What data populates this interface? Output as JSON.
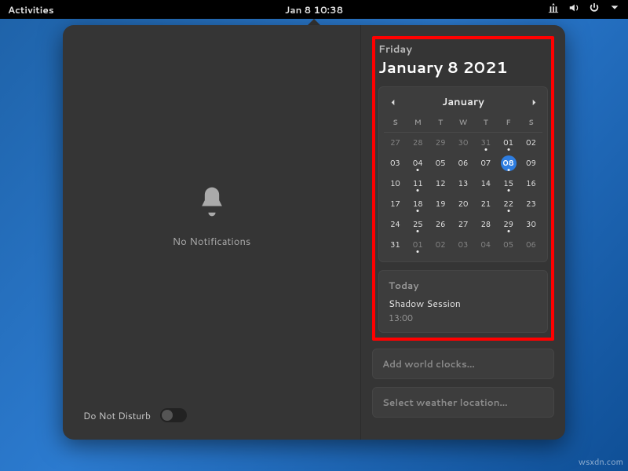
{
  "topbar": {
    "activities": "Activities",
    "clock": "Jan 8  10:38"
  },
  "notifications": {
    "empty_text": "No Notifications",
    "dnd_label": "Do Not Disturb",
    "dnd_on": false
  },
  "date_header": {
    "weekday": "Friday",
    "full_date": "January 8 2021"
  },
  "calendar": {
    "month_label": "January",
    "weekday_headers": [
      "S",
      "M",
      "T",
      "W",
      "T",
      "F",
      "S"
    ],
    "grid": [
      [
        {
          "n": "27",
          "in": false
        },
        {
          "n": "28",
          "in": false
        },
        {
          "n": "29",
          "in": false
        },
        {
          "n": "30",
          "in": false
        },
        {
          "n": "31",
          "in": false,
          "dot": true
        },
        {
          "n": "01",
          "in": true,
          "dot": true
        },
        {
          "n": "02",
          "in": true
        }
      ],
      [
        {
          "n": "03",
          "in": true
        },
        {
          "n": "04",
          "in": true,
          "dot": true
        },
        {
          "n": "05",
          "in": true
        },
        {
          "n": "06",
          "in": true
        },
        {
          "n": "07",
          "in": true
        },
        {
          "n": "08",
          "in": true,
          "today": true,
          "dot": true
        },
        {
          "n": "09",
          "in": true
        }
      ],
      [
        {
          "n": "10",
          "in": true
        },
        {
          "n": "11",
          "in": true,
          "dot": true
        },
        {
          "n": "12",
          "in": true
        },
        {
          "n": "13",
          "in": true
        },
        {
          "n": "14",
          "in": true
        },
        {
          "n": "15",
          "in": true,
          "dot": true
        },
        {
          "n": "16",
          "in": true
        }
      ],
      [
        {
          "n": "17",
          "in": true
        },
        {
          "n": "18",
          "in": true,
          "dot": true
        },
        {
          "n": "19",
          "in": true
        },
        {
          "n": "20",
          "in": true
        },
        {
          "n": "21",
          "in": true
        },
        {
          "n": "22",
          "in": true,
          "dot": true
        },
        {
          "n": "23",
          "in": true
        }
      ],
      [
        {
          "n": "24",
          "in": true
        },
        {
          "n": "25",
          "in": true,
          "dot": true
        },
        {
          "n": "26",
          "in": true
        },
        {
          "n": "27",
          "in": true
        },
        {
          "n": "28",
          "in": true
        },
        {
          "n": "29",
          "in": true,
          "dot": true
        },
        {
          "n": "30",
          "in": true
        }
      ],
      [
        {
          "n": "31",
          "in": true
        },
        {
          "n": "01",
          "in": false,
          "dot": true
        },
        {
          "n": "02",
          "in": false
        },
        {
          "n": "03",
          "in": false
        },
        {
          "n": "04",
          "in": false
        },
        {
          "n": "05",
          "in": false
        },
        {
          "n": "06",
          "in": false
        }
      ]
    ]
  },
  "today_card": {
    "header": "Today",
    "event_title": "Shadow Session",
    "event_time": "13:00"
  },
  "world_clocks": {
    "label": "Add world clocks…"
  },
  "weather": {
    "label": "Select weather location…"
  },
  "watermark": "wsxdn.com",
  "colors": {
    "accent": "#2e7de0",
    "highlight_border": "#ff0000"
  }
}
